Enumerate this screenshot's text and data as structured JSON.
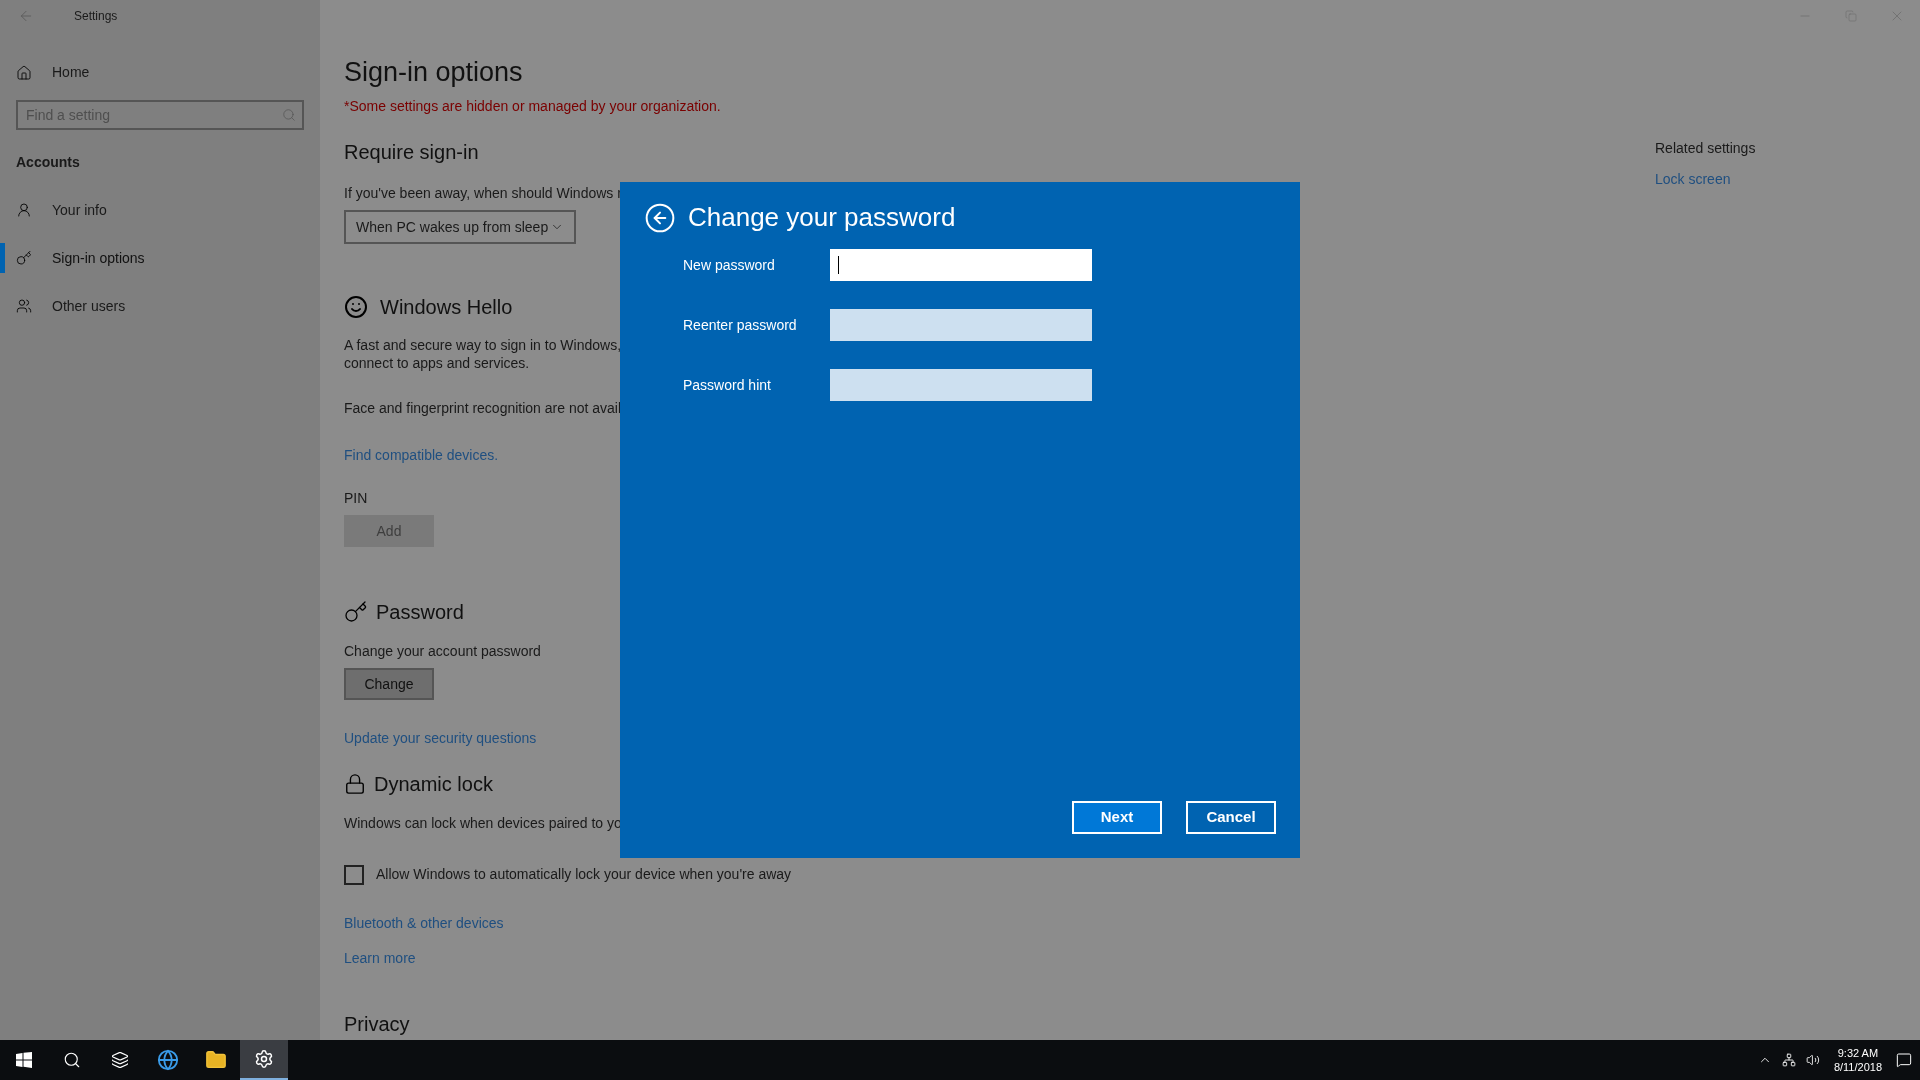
{
  "window": {
    "title": "Settings"
  },
  "sidebar": {
    "home": "Home",
    "search": {
      "placeholder": "Find a setting"
    },
    "section": "Accounts",
    "items": [
      {
        "label": "Your info",
        "kind": "info",
        "selected": false
      },
      {
        "label": "Sign-in options",
        "kind": "key",
        "selected": true
      },
      {
        "label": "Other users",
        "kind": "users",
        "selected": false
      }
    ]
  },
  "main": {
    "title": "Sign-in options",
    "notice": "*Some settings are hidden or managed by your organization.",
    "require_signin": {
      "heading": "Require sign-in",
      "question": "If you've been away, when should Windows r",
      "dropdown": "When PC wakes up from sleep"
    },
    "windows_hello": {
      "heading": "Windows Hello",
      "description": [
        "A fast and secure way to sign in to Windows,",
        "connect to apps and services."
      ],
      "note": "Face and fingerprint recognition are not avail",
      "link": "Find compatible devices.",
      "pin_label": "PIN",
      "pin_button": {
        "label": "Add",
        "disabled": true
      }
    },
    "password": {
      "heading": "Password",
      "description": "Change your account password",
      "button": {
        "label": "Change",
        "disabled": false
      },
      "link": "Update your security questions"
    },
    "dynamic_lock": {
      "heading": "Dynamic lock",
      "description": "Windows can lock when devices paired to yo",
      "checkbox": {
        "label": "Allow Windows to automatically lock your device when you're away",
        "checked": false
      },
      "links": [
        "Bluetooth & other devices",
        "Learn more"
      ]
    },
    "privacy": {
      "heading": "Privacy"
    }
  },
  "related_settings": {
    "heading": "Related settings",
    "link": "Lock screen"
  },
  "dialog": {
    "title": "Change your password",
    "fields": [
      {
        "label": "New password",
        "focused": true
      },
      {
        "label": "Reenter password",
        "focused": false
      },
      {
        "label": "Password hint",
        "focused": false
      }
    ],
    "buttons": [
      "Next",
      "Cancel"
    ]
  },
  "taskbar": {
    "apps": [
      {
        "kind": "start",
        "selected": false
      },
      {
        "kind": "search",
        "selected": false
      },
      {
        "kind": "taskview",
        "selected": false
      },
      {
        "kind": "browser",
        "selected": false
      },
      {
        "kind": "explorer",
        "selected": false
      },
      {
        "kind": "settings",
        "selected": true
      }
    ],
    "time": "9:32 AM",
    "date": "8/11/2018"
  }
}
